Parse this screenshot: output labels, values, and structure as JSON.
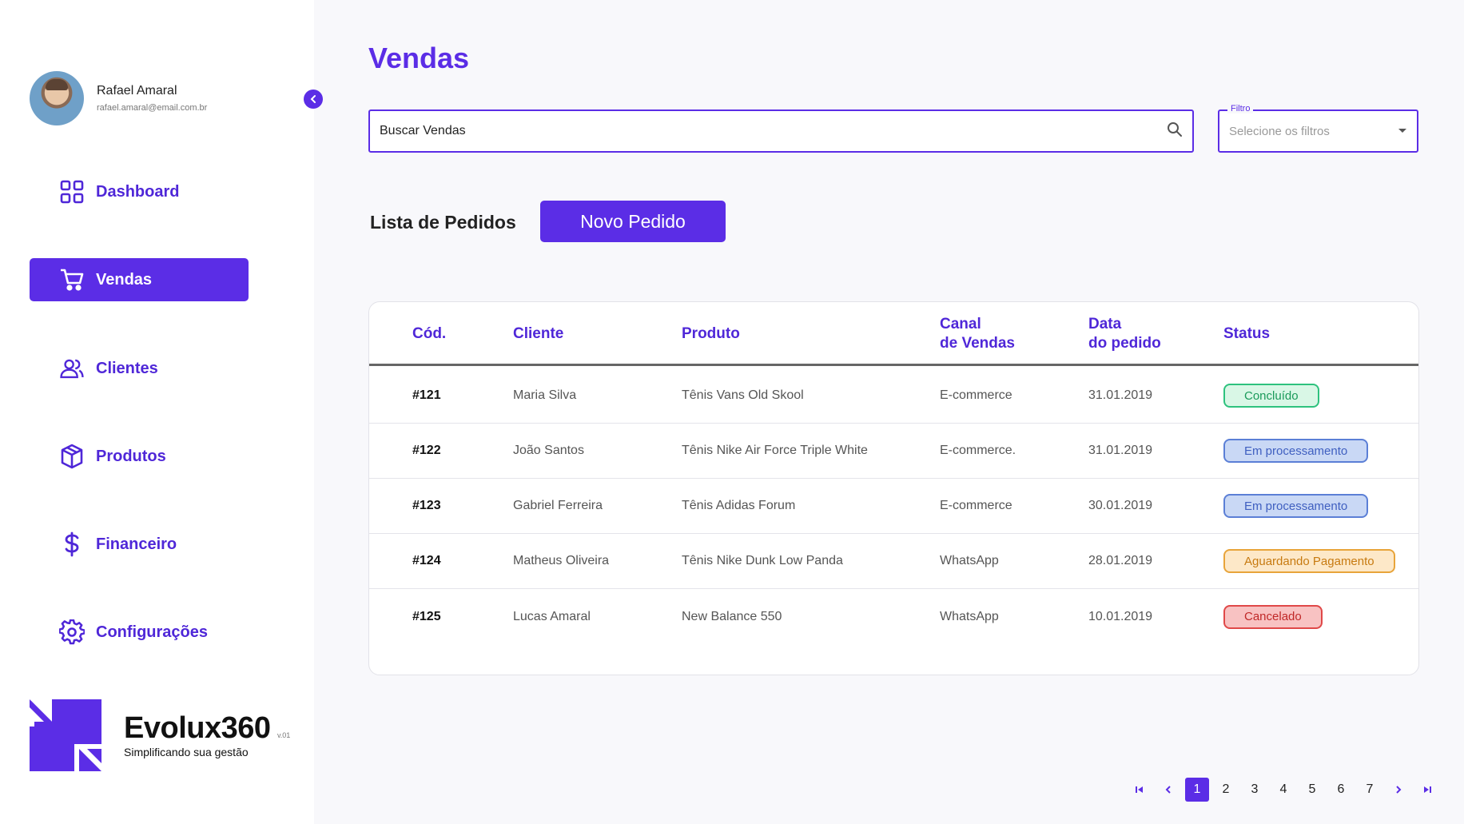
{
  "colors": {
    "accent": "#5b2de6",
    "background": "#f8f8fb"
  },
  "user": {
    "name": "Rafael Amaral",
    "email": "rafael.amaral@email.com.br"
  },
  "nav": {
    "items": [
      {
        "label": "Dashboard",
        "icon": "grid-icon",
        "active": false
      },
      {
        "label": "Vendas",
        "icon": "cart-icon",
        "active": true
      },
      {
        "label": "Clientes",
        "icon": "users-icon",
        "active": false
      },
      {
        "label": "Produtos",
        "icon": "box-icon",
        "active": false
      },
      {
        "label": "Financeiro",
        "icon": "dollar-icon",
        "active": false
      },
      {
        "label": "Configurações",
        "icon": "gear-icon",
        "active": false
      }
    ]
  },
  "brand": {
    "name": "Evolux360",
    "version": "v.01",
    "tagline": "Simplificando sua gestão"
  },
  "page": {
    "title": "Vendas"
  },
  "search": {
    "value": "Buscar Vendas",
    "icon": "search-icon"
  },
  "filter": {
    "legend": "Filtro",
    "placeholder": "Selecione os filtros"
  },
  "orders": {
    "title": "Lista de Pedidos",
    "new_button": "Novo Pedido",
    "columns": [
      "Cód.",
      "Cliente",
      "Produto",
      "Canal\nde Vendas",
      "Data\ndo pedido",
      "Status"
    ],
    "rows": [
      {
        "code": "#121",
        "client": "Maria Silva",
        "product": "Tênis Vans Old Skool",
        "channel": "E-commerce",
        "date": "31.01.2019",
        "status": "Concluído",
        "status_type": "success"
      },
      {
        "code": "#122",
        "client": "João Santos",
        "product": "Tênis Nike Air Force Triple White",
        "channel": "E-commerce.",
        "date": "31.01.2019",
        "status": "Em processamento",
        "status_type": "processing"
      },
      {
        "code": "#123",
        "client": "Gabriel Ferreira",
        "product": "Tênis Adidas Forum",
        "channel": "E-commerce",
        "date": "30.01.2019",
        "status": "Em processamento",
        "status_type": "processing"
      },
      {
        "code": "#124",
        "client": "Matheus Oliveira",
        "product": "Tênis Nike Dunk Low Panda",
        "channel": "WhatsApp",
        "date": "28.01.2019",
        "status": "Aguardando Pagamento",
        "status_type": "pending"
      },
      {
        "code": "#125",
        "client": "Lucas Amaral",
        "product": "New Balance 550",
        "channel": "WhatsApp",
        "date": "10.01.2019",
        "status": "Cancelado",
        "status_type": "cancelled"
      }
    ]
  },
  "status_colors": {
    "success": {
      "bg": "#d9f7e6",
      "border": "#2ec27e",
      "text": "#1a9a5a"
    },
    "processing": {
      "bg": "#c9d8f5",
      "border": "#5b7fd6",
      "text": "#3f5fc0"
    },
    "pending": {
      "bg": "#fde8c8",
      "border": "#e8a43a",
      "text": "#c77a10"
    },
    "cancelled": {
      "bg": "#f8c2c2",
      "border": "#e04848",
      "text": "#c02828"
    }
  },
  "pagination": {
    "pages": [
      "1",
      "2",
      "3",
      "4",
      "5",
      "6",
      "7"
    ],
    "current": "1"
  }
}
